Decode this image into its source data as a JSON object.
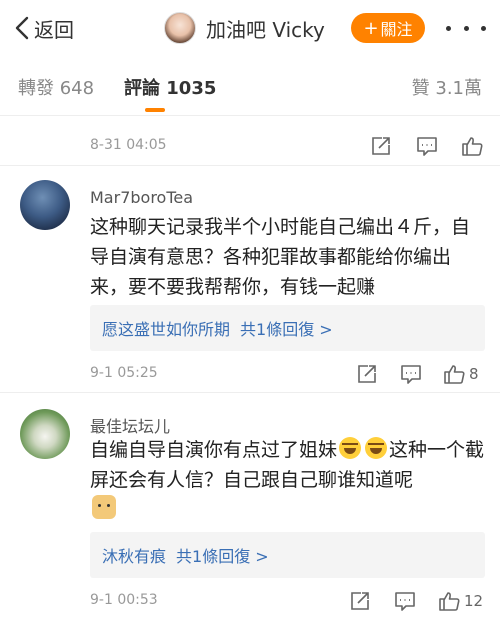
{
  "nav": {
    "back_label": "返回",
    "user_name": "加油吧 Vicky",
    "follow_plus": "+",
    "follow_label": "關注"
  },
  "tabs": {
    "repost": "轉發 648",
    "comments": "評論 1035",
    "likes": "贊 3.1萬"
  },
  "top_meta": {
    "time": "8-31 04:05"
  },
  "comments": [
    {
      "name": "Mar7boroTea",
      "text": "这种聊天记录我半个小时能自己编出４斤，自导自演有意思？各种犯罪故事都能给你编出来，要不要我帮帮你，有钱一起赚",
      "reply_name": "愿这盛世如你所期",
      "reply_count": "共1條回復 >",
      "time": "9-1 05:25",
      "likes": "8"
    },
    {
      "name": "最佳坛坛儿",
      "text_part1": "自编自导自演你有点过了姐妹",
      "text_part2": "这种一个截屏还会有人信？自己跟自己聊谁知道呢",
      "emoji_1": "laugh-emoji",
      "emoji_2": "laugh-emoji",
      "emoji_3": "doge-emoji",
      "reply_name": "沐秋有痕",
      "reply_count": "共1條回復 >",
      "time": "9-1 00:53",
      "likes": "12"
    }
  ],
  "icons": [
    "back-chevron-icon",
    "repost-icon",
    "comment-icon",
    "like-icon",
    "more-icon"
  ],
  "colors": {
    "accent": "#ff8200",
    "link": "#3a6fb5"
  }
}
